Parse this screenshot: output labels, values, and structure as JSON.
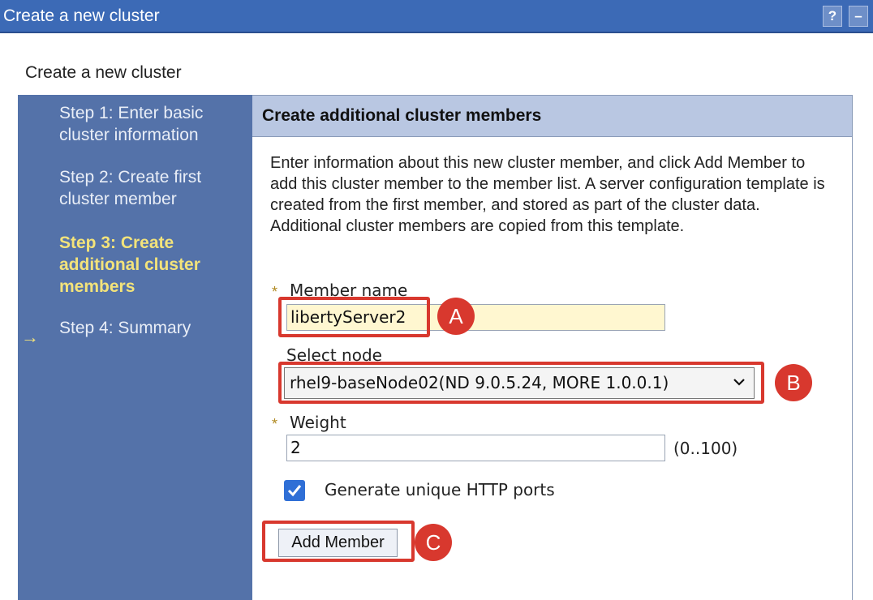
{
  "window": {
    "title": "Create a new cluster",
    "help_label": "?",
    "minimize_label": "–"
  },
  "page": {
    "heading": "Create a new cluster"
  },
  "nav": {
    "steps": [
      {
        "label": "Step 1: Enter basic cluster information",
        "active": false
      },
      {
        "label": "Step 2: Create first cluster member",
        "active": false
      },
      {
        "label": "Step 3: Create additional cluster members",
        "active": true
      },
      {
        "label": "Step 4: Summary",
        "active": false
      }
    ],
    "current_arrow": "→"
  },
  "panel": {
    "header": "Create additional cluster members",
    "description": "Enter information about this new cluster member, and click Add Member to add this cluster member to the member list. A server configuration template is created from the first member, and stored as part of the cluster data. Additional cluster members are copied from this template."
  },
  "form": {
    "required_marker": "*",
    "member_name_label": "Member name",
    "member_name_value": "libertyServer2",
    "select_node_label": "Select node",
    "select_node_value": "rhel9-baseNode02(ND 9.0.5.24, MORE 1.0.0.1)",
    "weight_label": "Weight",
    "weight_value": "2",
    "weight_range": "(0..100)",
    "generate_ports_label": "Generate unique HTTP ports",
    "generate_ports_checked": true,
    "add_member_label": "Add Member"
  },
  "annotations": {
    "a": "A",
    "b": "B",
    "c": "C",
    "color": "#d8382e"
  }
}
